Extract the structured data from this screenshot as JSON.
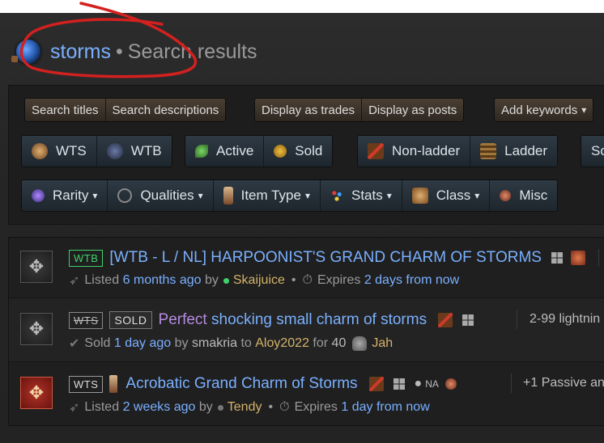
{
  "page": {
    "query": "storms",
    "separator": "•",
    "suffix": "Search results"
  },
  "filters": {
    "row1": [
      "Search titles",
      "Search descriptions",
      "Display as trades",
      "Display as posts",
      "Add keywords"
    ],
    "row2": [
      "WTS",
      "WTB",
      "Active",
      "Sold",
      "Non-ladder",
      "Ladder",
      "So"
    ],
    "row3": [
      "Rarity",
      "Qualities",
      "Item Type",
      "Stats",
      "Class",
      "Misc"
    ]
  },
  "results": [
    {
      "tag": "WTB",
      "title": "[WTB - L / NL] HARPOONIST'S GRAND CHARM OF STORMS",
      "meta": {
        "prefix": "Listed",
        "age": "6 months ago",
        "by": "by",
        "user": "Skaijuice",
        "bullet": "•",
        "expires_label": "Expires",
        "expires": "2 days from now"
      }
    },
    {
      "tag": "WTS",
      "status": "SOLD",
      "title_magic": "Perfect",
      "title_rest": "shocking small charm of storms",
      "side_text": "2-99 lightnin",
      "meta": {
        "prefix": "Sold",
        "age": "1 day ago",
        "by": "by",
        "user": "smakria",
        "to": "to",
        "buyer": "Aloy2022",
        "for": "for",
        "amount": "40",
        "currency": "Jah"
      }
    },
    {
      "tag": "WTS",
      "title": "Acrobatic Grand Charm of Storms",
      "region": "NA",
      "side_text": "+1 Passive an",
      "meta": {
        "prefix": "Listed",
        "age": "2 weeks ago",
        "by": "by",
        "user": "Tendy",
        "bullet": "•",
        "expires_label": "Expires",
        "expires": "1 day from now"
      }
    }
  ]
}
